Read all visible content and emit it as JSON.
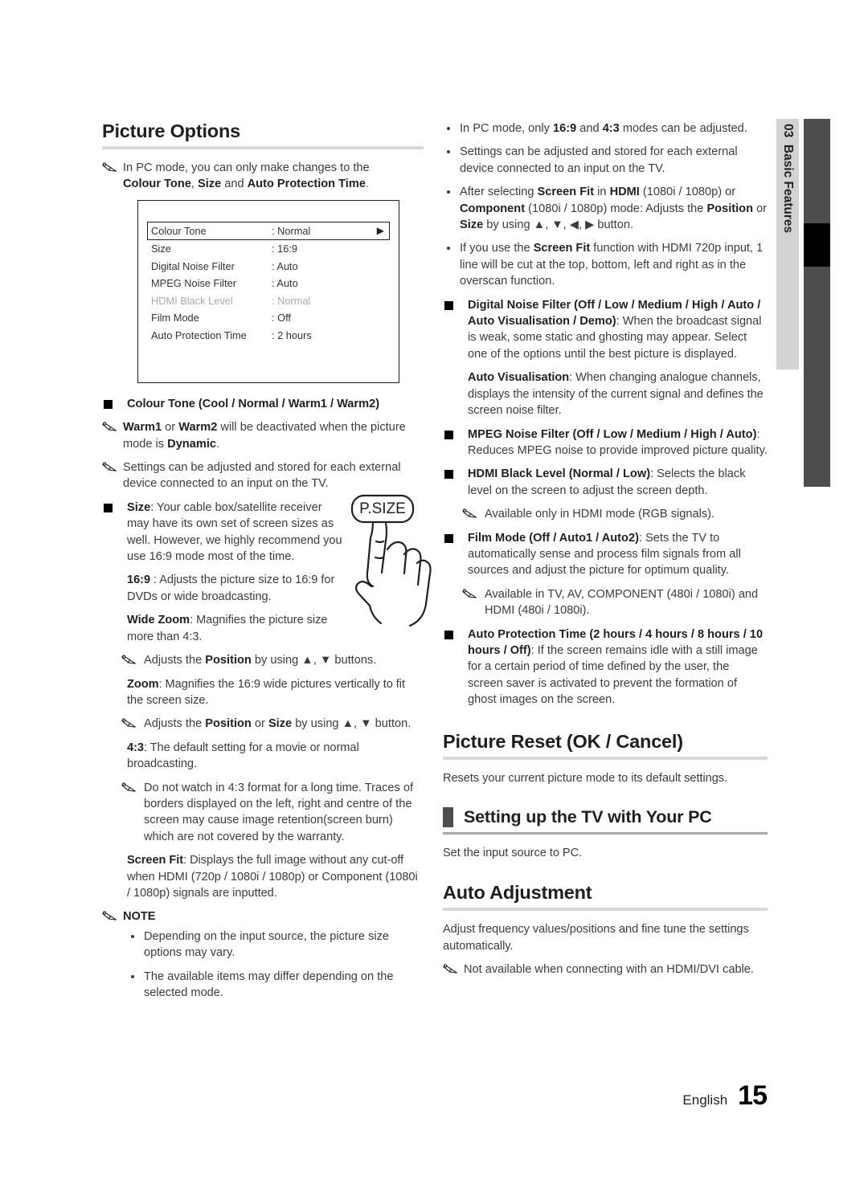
{
  "page": {
    "chapter_number": "03",
    "chapter_title": "Basic Features",
    "footer_language": "English",
    "footer_page": "15"
  },
  "left_column": {
    "heading": "Picture Options",
    "intro_note": {
      "line1": "In PC mode, you can only make changes to the",
      "bold1": "Colour Tone",
      "mid1": ", ",
      "bold2": "Size",
      "mid2": " and ",
      "bold3": "Auto Protection Time",
      "tail": "."
    },
    "osd": {
      "rows": [
        {
          "label": "Colour Tone",
          "value": ": Normal",
          "selected": true,
          "dim": false,
          "arrow": "▶"
        },
        {
          "label": "Size",
          "value": ": 16:9",
          "selected": false,
          "dim": false,
          "arrow": ""
        },
        {
          "label": "Digital Noise Filter",
          "value": ": Auto",
          "selected": false,
          "dim": false,
          "arrow": ""
        },
        {
          "label": "MPEG Noise Filter",
          "value": ": Auto",
          "selected": false,
          "dim": false,
          "arrow": ""
        },
        {
          "label": "HDMI Black Level",
          "value": ": Normal",
          "selected": false,
          "dim": true,
          "arrow": ""
        },
        {
          "label": "Film Mode",
          "value": ": Off",
          "selected": false,
          "dim": false,
          "arrow": ""
        },
        {
          "label": "Auto Protection Time",
          "value": ": 2 hours",
          "selected": false,
          "dim": false,
          "arrow": ""
        }
      ]
    },
    "colour_tone_heading": "Colour Tone (Cool / Normal / Warm1 / Warm2)",
    "note_warm_a": "Warm1",
    "note_warm_b": " or ",
    "note_warm_c": "Warm2",
    "note_warm_d": " will be deactivated when the picture mode is ",
    "note_warm_e": "Dynamic",
    "note_warm_f": ".",
    "note_settings_stored": "Settings can be adjusted and stored for each external device connected to an input on the TV.",
    "size_bold": "Size",
    "size_text": ": Your cable box/satellite receiver may have its own set of screen sizes as well. However, we highly recommend you use 16:9 mode most of the time.",
    "remote_button_label": "P.SIZE",
    "s169_bold": "16:9",
    "s169_text": " : Adjusts the picture size to 16:9 for DVDs or wide broadcasting.",
    "widezoom_bold": "Wide Zoom",
    "widezoom_text": ": Magnifies the picture size more than 4:3.",
    "widezoom_note_a": "Adjusts the ",
    "widezoom_note_b": "Position",
    "widezoom_note_c": " by using ▲, ▼ buttons.",
    "zoom_bold": "Zoom",
    "zoom_text": ": Magnifies the 16:9 wide pictures vertically to fit the screen size.",
    "zoom_note_a": "Adjusts the ",
    "zoom_note_b": "Position",
    "zoom_note_c": " or ",
    "zoom_note_d": "Size",
    "zoom_note_e": " by using ▲, ▼ button.",
    "s43_bold": "4:3",
    "s43_text": ": The default setting for a movie or normal broadcasting.",
    "s43_note": "Do not watch in 4:3 format for a long time. Traces of borders displayed on the left, right and centre of the screen may cause image retention(screen burn) which are not covered by the warranty.",
    "screenfit_bold": "Screen Fit",
    "screenfit_text": ": Displays the full image without any cut-off when HDMI (720p / 1080i / 1080p) or Component (1080i / 1080p) signals are inputted.",
    "note_title": "NOTE",
    "note_bullets": [
      "Depending on the input source, the picture size options may vary.",
      "The available items may differ depending on the selected mode."
    ]
  },
  "right_column": {
    "top_bullets": [
      {
        "parts": [
          {
            "t": "In PC mode, only ",
            "b": false
          },
          {
            "t": "16:9",
            "b": true
          },
          {
            "t": " and ",
            "b": false
          },
          {
            "t": "4:3",
            "b": true
          },
          {
            "t": " modes can be adjusted.",
            "b": false
          }
        ]
      },
      {
        "parts": [
          {
            "t": "Settings can be adjusted and stored for each external device connected to an input on the TV.",
            "b": false
          }
        ]
      },
      {
        "parts": [
          {
            "t": "After selecting ",
            "b": false
          },
          {
            "t": "Screen Fit",
            "b": true
          },
          {
            "t": " in ",
            "b": false
          },
          {
            "t": "HDMI",
            "b": true
          },
          {
            "t": " (1080i / 1080p) or ",
            "b": false
          },
          {
            "t": "Component",
            "b": true
          },
          {
            "t": " (1080i / 1080p) mode: Adjusts the ",
            "b": false
          },
          {
            "t": "Position",
            "b": true
          },
          {
            "t": " or ",
            "b": false
          },
          {
            "t": "Size",
            "b": true
          },
          {
            "t": " by using ▲, ▼, ◀, ▶ button.",
            "b": false
          }
        ]
      },
      {
        "parts": [
          {
            "t": "If you use the ",
            "b": false
          },
          {
            "t": "Screen Fit",
            "b": true
          },
          {
            "t": " function with HDMI 720p input, 1 line will be cut at the top, bottom, left and right as in the overscan function.",
            "b": false
          }
        ]
      }
    ],
    "dnf_bold": "Digital Noise Filter (Off / Low / Medium / High / Auto / Auto Visualisation / Demo)",
    "dnf_text": ": When the broadcast signal is weak, some static and ghosting may appear. Select one of the options until the best picture is displayed.",
    "autovis_bold": "Auto Visualisation",
    "autovis_text": ": When changing analogue channels, displays the intensity of the current signal and defines the screen noise filter.",
    "mpeg_bold": "MPEG Noise Filter (Off / Low / Medium / High / Auto)",
    "mpeg_text": ": Reduces MPEG noise to provide improved picture quality.",
    "hdmi_bold": "HDMI Black Level (Normal / Low)",
    "hdmi_text": ": Selects the black level on the screen to adjust the screen depth.",
    "hdmi_note": "Available only in HDMI mode (RGB signals).",
    "film_bold": "Film Mode (Off / Auto1 / Auto2)",
    "film_text": ": Sets the TV to automatically sense and process film signals from all sources and adjust the picture for optimum quality.",
    "film_note": "Available in TV, AV, COMPONENT (480i / 1080i) and HDMI (480i / 1080i).",
    "apt_bold": "Auto Protection Time (2 hours / 4 hours / 8 hours / 10 hours / Off)",
    "apt_text": ": If the screen remains idle with a still image for a certain period of time defined by the user, the screen saver is activated to prevent the formation of ghost images on the screen.",
    "picture_reset_heading": "Picture Reset (OK / Cancel)",
    "picture_reset_text": "Resets your current picture mode to its default settings.",
    "setting_up_heading": "Setting up the TV with Your PC",
    "setting_up_text": "Set the input source to PC.",
    "auto_adjustment_heading": "Auto Adjustment",
    "auto_adjustment_text": "Adjust frequency values/positions and fine tune the settings automatically.",
    "auto_adjustment_note": "Not available when connecting with an HDMI/DVI cable."
  },
  "colors": {
    "rule": "#d9d9d9",
    "tab_bg": "#d2d2d2",
    "tab_bar": "#4d4d4d",
    "tab_active": "#000000",
    "text": "#3c3c3c"
  }
}
